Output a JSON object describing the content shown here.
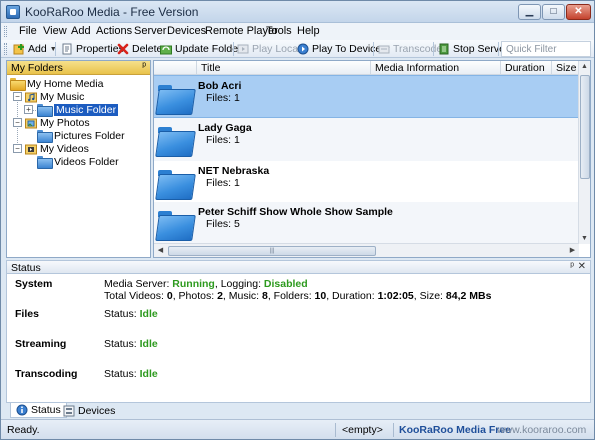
{
  "window": {
    "title": "KooRaRoo Media - Free Version",
    "controls": {
      "minimize": "▁",
      "maximize": "□",
      "close": "✕"
    }
  },
  "menu": [
    "File",
    "View",
    "Add",
    "Actions",
    "Server",
    "Devices",
    "Remote Player",
    "Tools",
    "Help"
  ],
  "toolbar": {
    "add": "Add",
    "properties": "Properties",
    "delete": "Delete",
    "update_folder": "Update Folder",
    "play_locally": "Play Locally",
    "play_to_device": "Play To Device",
    "transcode": "Transcode",
    "stop_server": "Stop Server",
    "quick_filter_placeholder": "Quick Filter"
  },
  "folders_panel": {
    "header": "My Folders",
    "pin": "ᵖ",
    "tree": {
      "root": "My Home Media",
      "music": "My Music",
      "music_folder": "Music Folder",
      "photos": "My Photos",
      "pictures_folder": "Pictures Folder",
      "videos": "My Videos",
      "videos_folder": "Videos Folder"
    }
  },
  "table": {
    "columns": [
      "Title",
      "Media Information",
      "Duration",
      "Size"
    ],
    "rows": [
      {
        "title": "Bob Acri",
        "files": "Files: 1"
      },
      {
        "title": "Lady Gaga",
        "files": "Files: 1"
      },
      {
        "title": "NET Nebraska",
        "files": "Files: 1"
      },
      {
        "title": "Peter Schiff Show Whole Show Sample",
        "files": "Files: 5"
      }
    ],
    "selected_row": 0
  },
  "status": {
    "header": "Status",
    "system_label": "System",
    "media_server_prefix": "Media Server: ",
    "media_server_value": "Running",
    "logging_prefix": ", Logging: ",
    "logging_value": "Disabled",
    "totals": {
      "videos_label": "Total Videos: ",
      "videos": "0",
      "photos_label": ", Photos: ",
      "photos": "2",
      "music_label": ", Music: ",
      "music": "8",
      "folders_label": ", Folders: ",
      "folders": "10",
      "duration_label": ", Duration: ",
      "duration": "1:02:05",
      "size_label": ", Size: ",
      "size": "84,2 MBs"
    },
    "files_label": "Files",
    "streaming_label": "Streaming",
    "transcoding_label": "Transcoding",
    "status_prefix": "Status: ",
    "files_status": "Idle",
    "streaming_status": "Idle",
    "transcoding_status": "Idle"
  },
  "tabs": [
    "Status",
    "Devices"
  ],
  "statusbar": {
    "ready": "Ready.",
    "empty": "<empty>",
    "brand": "KooRaRoo Media Free",
    "url": "www.kooraroo.com"
  },
  "colors": {
    "accent": "#1c5cc0",
    "selection": "#a8cdf3",
    "status_green": "#2d9a1e",
    "folders_header": "#e9c24b"
  }
}
